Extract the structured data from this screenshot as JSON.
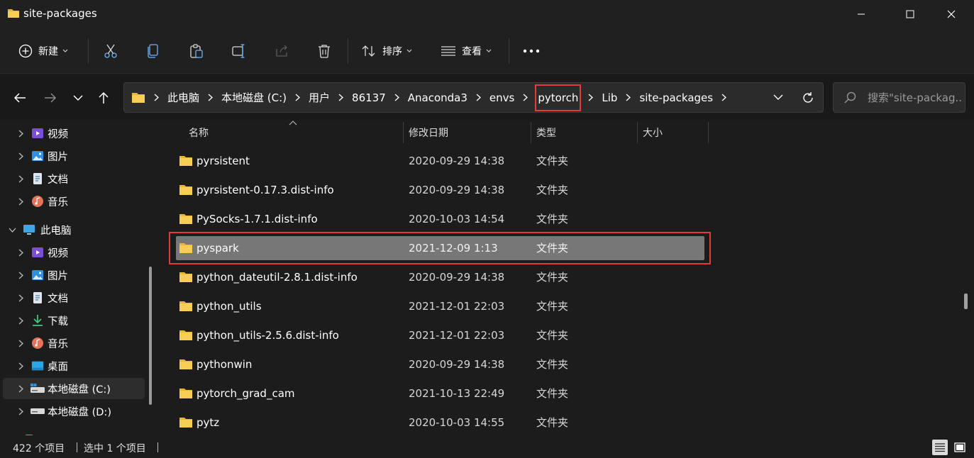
{
  "window": {
    "title": "site-packages",
    "controls": {
      "minimize": "minimize",
      "maximize": "maximize",
      "close": "close"
    }
  },
  "toolbar": {
    "new_label": "新建",
    "sort_label": "排序",
    "view_label": "查看",
    "icons": [
      "cut-icon",
      "copy-icon",
      "paste-icon",
      "rename-icon",
      "share-icon",
      "delete-icon",
      "more-icon"
    ]
  },
  "address": {
    "crumbs": [
      "此电脑",
      "本地磁盘 (C:)",
      "用户",
      "86137",
      "Anaconda3",
      "envs",
      "pytorch",
      "Lib",
      "site-packages"
    ],
    "highlighted_crumb": "pytorch"
  },
  "search": {
    "placeholder": "搜索\"site-packag..."
  },
  "sidebar": {
    "items": [
      {
        "label": "视频",
        "icon": "video-icon"
      },
      {
        "label": "图片",
        "icon": "pictures-icon"
      },
      {
        "label": "文档",
        "icon": "documents-icon"
      },
      {
        "label": "音乐",
        "icon": "music-icon"
      },
      {
        "label": "此电脑",
        "icon": "computer-icon",
        "expanded": true
      },
      {
        "label": "视频",
        "icon": "video-icon"
      },
      {
        "label": "图片",
        "icon": "pictures-icon"
      },
      {
        "label": "文档",
        "icon": "documents-icon"
      },
      {
        "label": "下载",
        "icon": "download-icon"
      },
      {
        "label": "音乐",
        "icon": "music-icon"
      },
      {
        "label": "桌面",
        "icon": "desktop-icon"
      },
      {
        "label": "本地磁盘 (C:)",
        "icon": "drive-icon",
        "selected": true
      },
      {
        "label": "本地磁盘 (D:)",
        "icon": "drive-icon"
      }
    ]
  },
  "columns": {
    "name": "名称",
    "date": "修改日期",
    "type": "类型",
    "size": "大小"
  },
  "files": [
    {
      "name": "pyrsistent",
      "date": "2020-09-29 14:38",
      "type": "文件夹"
    },
    {
      "name": "pyrsistent-0.17.3.dist-info",
      "date": "2020-09-29 14:38",
      "type": "文件夹"
    },
    {
      "name": "PySocks-1.7.1.dist-info",
      "date": "2020-10-03 14:54",
      "type": "文件夹"
    },
    {
      "name": "pyspark",
      "date": "2021-12-09 1:13",
      "type": "文件夹",
      "selected": true
    },
    {
      "name": "python_dateutil-2.8.1.dist-info",
      "date": "2020-09-29 14:38",
      "type": "文件夹"
    },
    {
      "name": "python_utils",
      "date": "2021-12-01 22:03",
      "type": "文件夹"
    },
    {
      "name": "python_utils-2.5.6.dist-info",
      "date": "2021-12-01 22:03",
      "type": "文件夹"
    },
    {
      "name": "pythonwin",
      "date": "2020-09-29 14:38",
      "type": "文件夹"
    },
    {
      "name": "pytorch_grad_cam",
      "date": "2021-10-13 22:49",
      "type": "文件夹"
    },
    {
      "name": "pytz",
      "date": "2020-10-03 14:55",
      "type": "文件夹"
    }
  ],
  "status": {
    "item_count": "422 个项目",
    "selected_count": "选中 1 个项目"
  },
  "colors": {
    "accent_highlight": "#e33b3b",
    "folder": "#f4c542",
    "selected_row": "#777777"
  }
}
